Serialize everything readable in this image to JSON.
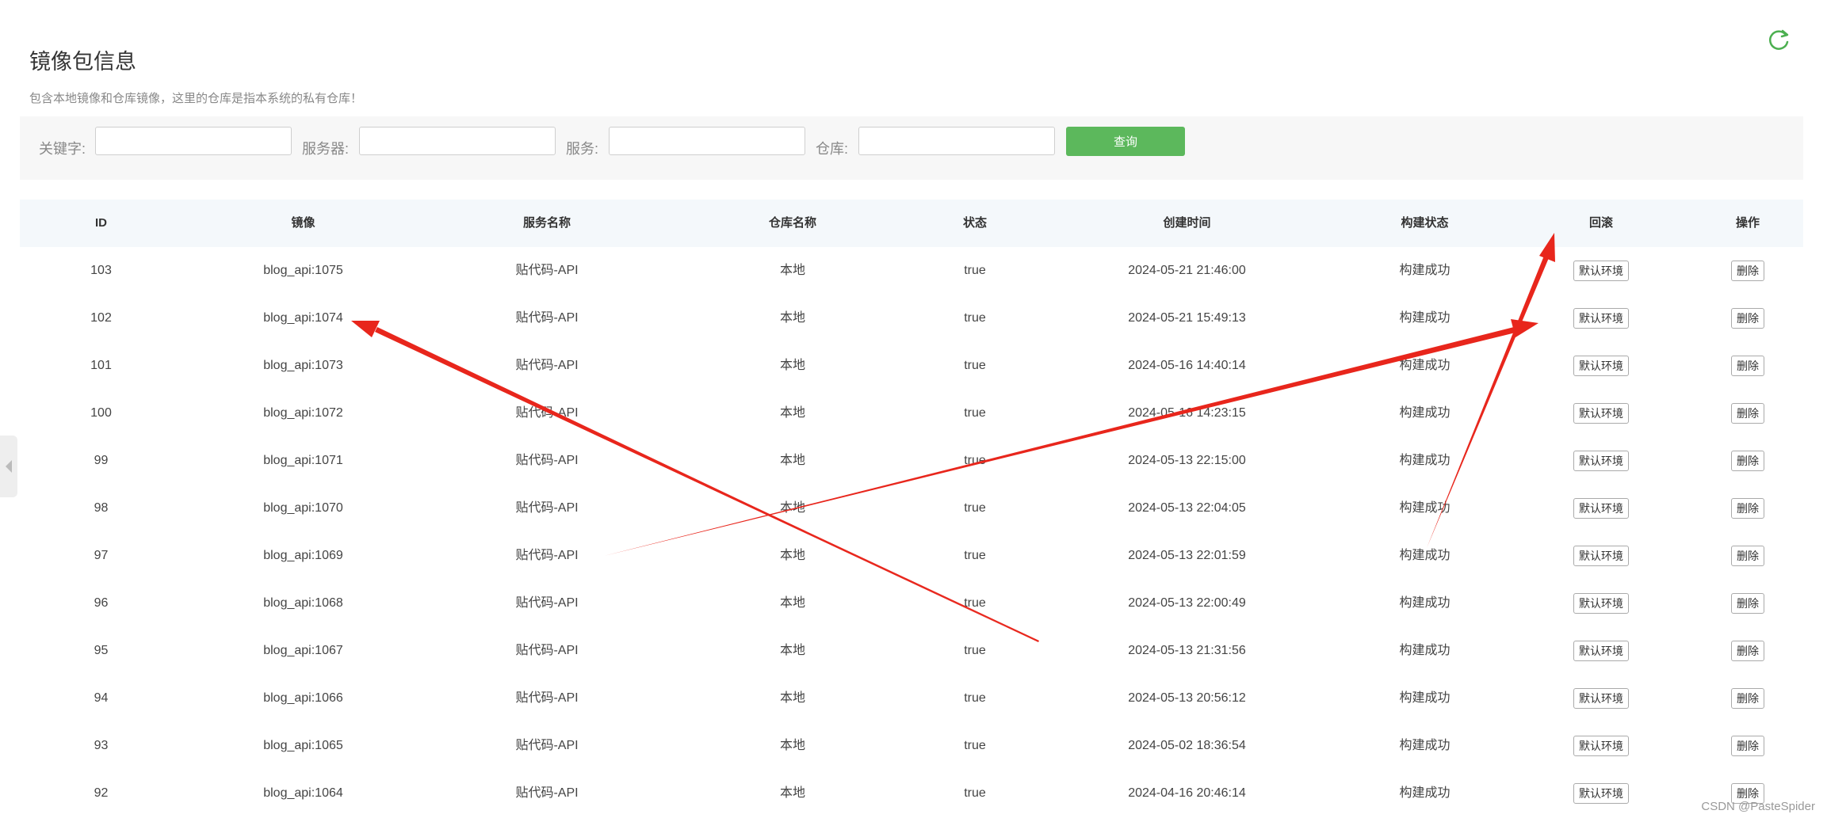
{
  "header": {
    "title": "镜像包信息",
    "subtitle": "包含本地镜像和仓库镜像，这里的仓库是指本系统的私有仓库！"
  },
  "filters": {
    "keyword_label": "关键字:",
    "server_label": "服务器:",
    "service_label": "服务:",
    "repo_label": "仓库:",
    "search_label": "查询"
  },
  "table": {
    "columns": [
      "ID",
      "镜像",
      "服务名称",
      "仓库名称",
      "状态",
      "创建时间",
      "构建状态",
      "回滚",
      "操作"
    ],
    "rows": [
      {
        "id": "103",
        "image": "blog_api:1075",
        "service": "贴代码-API",
        "repo": "本地",
        "state": "true",
        "created": "2024-05-21 21:46:00",
        "build": "构建成功",
        "rollback": "默认环境",
        "op": "删除"
      },
      {
        "id": "102",
        "image": "blog_api:1074",
        "service": "贴代码-API",
        "repo": "本地",
        "state": "true",
        "created": "2024-05-21 15:49:13",
        "build": "构建成功",
        "rollback": "默认环境",
        "op": "删除"
      },
      {
        "id": "101",
        "image": "blog_api:1073",
        "service": "贴代码-API",
        "repo": "本地",
        "state": "true",
        "created": "2024-05-16 14:40:14",
        "build": "构建成功",
        "rollback": "默认环境",
        "op": "删除"
      },
      {
        "id": "100",
        "image": "blog_api:1072",
        "service": "贴代码-API",
        "repo": "本地",
        "state": "true",
        "created": "2024-05-16 14:23:15",
        "build": "构建成功",
        "rollback": "默认环境",
        "op": "删除"
      },
      {
        "id": "99",
        "image": "blog_api:1071",
        "service": "贴代码-API",
        "repo": "本地",
        "state": "true",
        "created": "2024-05-13 22:15:00",
        "build": "构建成功",
        "rollback": "默认环境",
        "op": "删除"
      },
      {
        "id": "98",
        "image": "blog_api:1070",
        "service": "贴代码-API",
        "repo": "本地",
        "state": "true",
        "created": "2024-05-13 22:04:05",
        "build": "构建成功",
        "rollback": "默认环境",
        "op": "删除"
      },
      {
        "id": "97",
        "image": "blog_api:1069",
        "service": "贴代码-API",
        "repo": "本地",
        "state": "true",
        "created": "2024-05-13 22:01:59",
        "build": "构建成功",
        "rollback": "默认环境",
        "op": "删除"
      },
      {
        "id": "96",
        "image": "blog_api:1068",
        "service": "贴代码-API",
        "repo": "本地",
        "state": "true",
        "created": "2024-05-13 22:00:49",
        "build": "构建成功",
        "rollback": "默认环境",
        "op": "删除"
      },
      {
        "id": "95",
        "image": "blog_api:1067",
        "service": "贴代码-API",
        "repo": "本地",
        "state": "true",
        "created": "2024-05-13 21:31:56",
        "build": "构建成功",
        "rollback": "默认环境",
        "op": "删除"
      },
      {
        "id": "94",
        "image": "blog_api:1066",
        "service": "贴代码-API",
        "repo": "本地",
        "state": "true",
        "created": "2024-05-13 20:56:12",
        "build": "构建成功",
        "rollback": "默认环境",
        "op": "删除"
      },
      {
        "id": "93",
        "image": "blog_api:1065",
        "service": "贴代码-API",
        "repo": "本地",
        "state": "true",
        "created": "2024-05-02 18:36:54",
        "build": "构建成功",
        "rollback": "默认环境",
        "op": "删除"
      },
      {
        "id": "92",
        "image": "blog_api:1064",
        "service": "贴代码-API",
        "repo": "本地",
        "state": "true",
        "created": "2024-04-16 20:46:14",
        "build": "构建成功",
        "rollback": "默认环境",
        "op": "删除"
      }
    ]
  },
  "watermark": "CSDN @PasteSpider",
  "icons": {
    "refresh": "refresh-icon",
    "side_toggle": "collapse-left-icon"
  },
  "colors": {
    "primary_button": "#5cb85c",
    "annotation_arrow": "#e8261c",
    "refresh_icon": "#4caf50"
  }
}
